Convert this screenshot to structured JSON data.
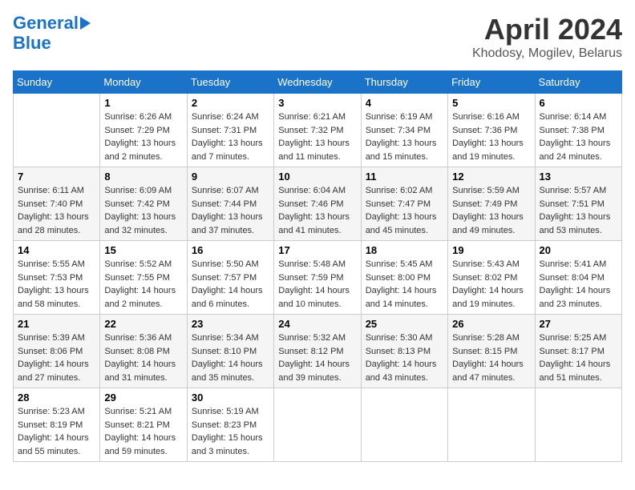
{
  "logo": {
    "line1": "General",
    "line2": "Blue"
  },
  "title": "April 2024",
  "location": "Khodosy, Mogilev, Belarus",
  "weekdays": [
    "Sunday",
    "Monday",
    "Tuesday",
    "Wednesday",
    "Thursday",
    "Friday",
    "Saturday"
  ],
  "weeks": [
    [
      {
        "day": "",
        "sunrise": "",
        "sunset": "",
        "daylight": ""
      },
      {
        "day": "1",
        "sunrise": "6:26 AM",
        "sunset": "7:29 PM",
        "daylight": "13 hours and 2 minutes."
      },
      {
        "day": "2",
        "sunrise": "6:24 AM",
        "sunset": "7:31 PM",
        "daylight": "13 hours and 7 minutes."
      },
      {
        "day": "3",
        "sunrise": "6:21 AM",
        "sunset": "7:32 PM",
        "daylight": "13 hours and 11 minutes."
      },
      {
        "day": "4",
        "sunrise": "6:19 AM",
        "sunset": "7:34 PM",
        "daylight": "13 hours and 15 minutes."
      },
      {
        "day": "5",
        "sunrise": "6:16 AM",
        "sunset": "7:36 PM",
        "daylight": "13 hours and 19 minutes."
      },
      {
        "day": "6",
        "sunrise": "6:14 AM",
        "sunset": "7:38 PM",
        "daylight": "13 hours and 24 minutes."
      }
    ],
    [
      {
        "day": "7",
        "sunrise": "6:11 AM",
        "sunset": "7:40 PM",
        "daylight": "13 hours and 28 minutes."
      },
      {
        "day": "8",
        "sunrise": "6:09 AM",
        "sunset": "7:42 PM",
        "daylight": "13 hours and 32 minutes."
      },
      {
        "day": "9",
        "sunrise": "6:07 AM",
        "sunset": "7:44 PM",
        "daylight": "13 hours and 37 minutes."
      },
      {
        "day": "10",
        "sunrise": "6:04 AM",
        "sunset": "7:46 PM",
        "daylight": "13 hours and 41 minutes."
      },
      {
        "day": "11",
        "sunrise": "6:02 AM",
        "sunset": "7:47 PM",
        "daylight": "13 hours and 45 minutes."
      },
      {
        "day": "12",
        "sunrise": "5:59 AM",
        "sunset": "7:49 PM",
        "daylight": "13 hours and 49 minutes."
      },
      {
        "day": "13",
        "sunrise": "5:57 AM",
        "sunset": "7:51 PM",
        "daylight": "13 hours and 53 minutes."
      }
    ],
    [
      {
        "day": "14",
        "sunrise": "5:55 AM",
        "sunset": "7:53 PM",
        "daylight": "13 hours and 58 minutes."
      },
      {
        "day": "15",
        "sunrise": "5:52 AM",
        "sunset": "7:55 PM",
        "daylight": "14 hours and 2 minutes."
      },
      {
        "day": "16",
        "sunrise": "5:50 AM",
        "sunset": "7:57 PM",
        "daylight": "14 hours and 6 minutes."
      },
      {
        "day": "17",
        "sunrise": "5:48 AM",
        "sunset": "7:59 PM",
        "daylight": "14 hours and 10 minutes."
      },
      {
        "day": "18",
        "sunrise": "5:45 AM",
        "sunset": "8:00 PM",
        "daylight": "14 hours and 14 minutes."
      },
      {
        "day": "19",
        "sunrise": "5:43 AM",
        "sunset": "8:02 PM",
        "daylight": "14 hours and 19 minutes."
      },
      {
        "day": "20",
        "sunrise": "5:41 AM",
        "sunset": "8:04 PM",
        "daylight": "14 hours and 23 minutes."
      }
    ],
    [
      {
        "day": "21",
        "sunrise": "5:39 AM",
        "sunset": "8:06 PM",
        "daylight": "14 hours and 27 minutes."
      },
      {
        "day": "22",
        "sunrise": "5:36 AM",
        "sunset": "8:08 PM",
        "daylight": "14 hours and 31 minutes."
      },
      {
        "day": "23",
        "sunrise": "5:34 AM",
        "sunset": "8:10 PM",
        "daylight": "14 hours and 35 minutes."
      },
      {
        "day": "24",
        "sunrise": "5:32 AM",
        "sunset": "8:12 PM",
        "daylight": "14 hours and 39 minutes."
      },
      {
        "day": "25",
        "sunrise": "5:30 AM",
        "sunset": "8:13 PM",
        "daylight": "14 hours and 43 minutes."
      },
      {
        "day": "26",
        "sunrise": "5:28 AM",
        "sunset": "8:15 PM",
        "daylight": "14 hours and 47 minutes."
      },
      {
        "day": "27",
        "sunrise": "5:25 AM",
        "sunset": "8:17 PM",
        "daylight": "14 hours and 51 minutes."
      }
    ],
    [
      {
        "day": "28",
        "sunrise": "5:23 AM",
        "sunset": "8:19 PM",
        "daylight": "14 hours and 55 minutes."
      },
      {
        "day": "29",
        "sunrise": "5:21 AM",
        "sunset": "8:21 PM",
        "daylight": "14 hours and 59 minutes."
      },
      {
        "day": "30",
        "sunrise": "5:19 AM",
        "sunset": "8:23 PM",
        "daylight": "15 hours and 3 minutes."
      },
      {
        "day": "",
        "sunrise": "",
        "sunset": "",
        "daylight": ""
      },
      {
        "day": "",
        "sunrise": "",
        "sunset": "",
        "daylight": ""
      },
      {
        "day": "",
        "sunrise": "",
        "sunset": "",
        "daylight": ""
      },
      {
        "day": "",
        "sunrise": "",
        "sunset": "",
        "daylight": ""
      }
    ]
  ],
  "labels": {
    "sunrise_prefix": "Sunrise: ",
    "sunset_prefix": "Sunset: ",
    "daylight_prefix": "Daylight: "
  }
}
